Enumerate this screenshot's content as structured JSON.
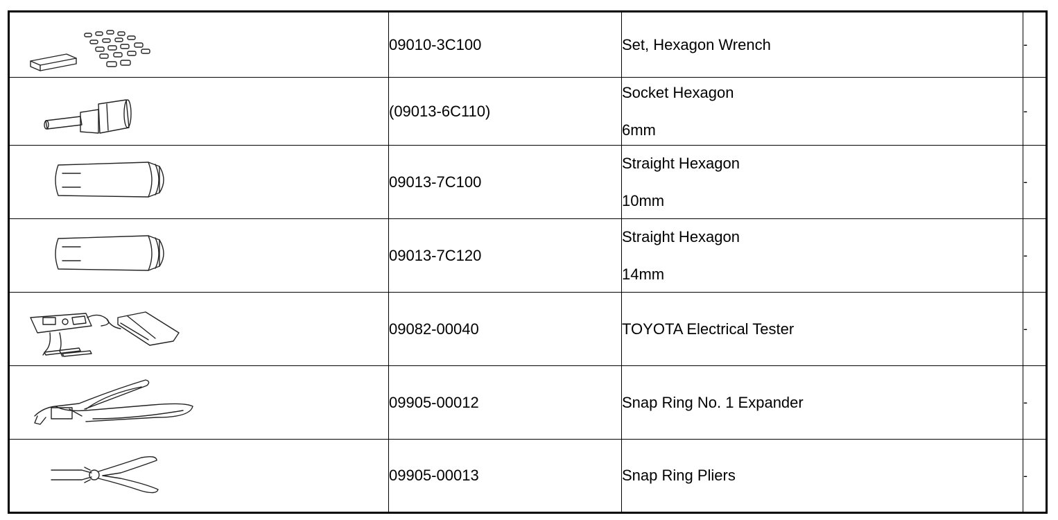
{
  "rows": [
    {
      "part_number": "09010-3C100",
      "name": "Set, Hexagon Wrench",
      "size": "",
      "note": "-",
      "icon": "hexagon-wrench-set-icon"
    },
    {
      "part_number": "(09013-6C110)",
      "name": "Socket Hexagon",
      "size": "6mm",
      "note": "-",
      "icon": "hexagon-socket-icon"
    },
    {
      "part_number": "09013-7C100",
      "name": "Straight Hexagon",
      "size": "10mm",
      "note": "-",
      "icon": "straight-hexagon-icon"
    },
    {
      "part_number": "09013-7C120",
      "name": "Straight Hexagon",
      "size": "14mm",
      "note": "-",
      "icon": "straight-hexagon-icon"
    },
    {
      "part_number": "09082-00040",
      "name": "TOYOTA Electrical Tester",
      "size": "",
      "note": "-",
      "icon": "electrical-tester-icon"
    },
    {
      "part_number": "09905-00012",
      "name": "Snap Ring No. 1 Expander",
      "size": "",
      "note": "-",
      "icon": "snap-ring-expander-icon"
    },
    {
      "part_number": "09905-00013",
      "name": "Snap Ring Pliers",
      "size": "",
      "note": "-",
      "icon": "snap-ring-pliers-icon"
    }
  ]
}
